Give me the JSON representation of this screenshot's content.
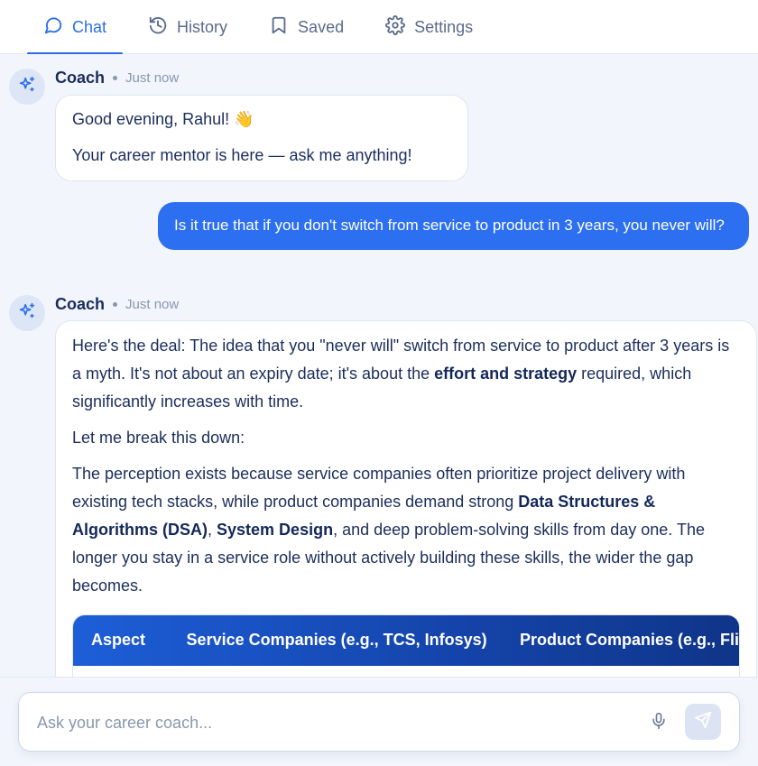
{
  "tabs": [
    {
      "label": "Chat",
      "icon": "chat-bubble-icon",
      "active": true
    },
    {
      "label": "History",
      "icon": "history-icon",
      "active": false
    },
    {
      "label": "Saved",
      "icon": "bookmark-icon",
      "active": false
    },
    {
      "label": "Settings",
      "icon": "gear-icon",
      "active": false
    }
  ],
  "messages": [
    {
      "sender": "Coach",
      "time": "Just now",
      "paragraphs": [
        "Good evening, Rahul! 👋",
        "Your career mentor is here — ask me anything!"
      ]
    },
    {
      "sender": "user",
      "text": "Is it true that if you don't switch from service to product in 3 years, you never will?"
    },
    {
      "sender": "Coach",
      "time": "Just now",
      "p1_before": "Here's the deal: The idea that you \"never will\" switch from service to product after 3 years is a myth. It's not about an expiry date; it's about the ",
      "p1_bold": "effort and strategy",
      "p1_after": " required, which significantly increases with time.",
      "p2": "Let me break this down:",
      "p3_a": "The perception exists because service companies often prioritize project delivery with existing tech stacks, while product companies demand strong ",
      "p3_b1": "Data Structures & Algorithms (DSA)",
      "p3_c": ", ",
      "p3_b2": "System Design",
      "p3_d": ", and deep problem-solving skills from day one. The longer you stay in a service role without actively building these skills, the wider the gap becomes.",
      "table_headers": [
        "Aspect",
        "Service Companies (e.g., TCS, Infosys)",
        "Product Companies (e.g., Fli"
      ]
    }
  ],
  "composer": {
    "placeholder": "Ask your career coach...",
    "value": ""
  },
  "colors": {
    "accent": "#2b6de8",
    "user_bubble": "#2c6ff0",
    "text_dark": "#1b2d5c",
    "muted": "#8b97ad"
  }
}
